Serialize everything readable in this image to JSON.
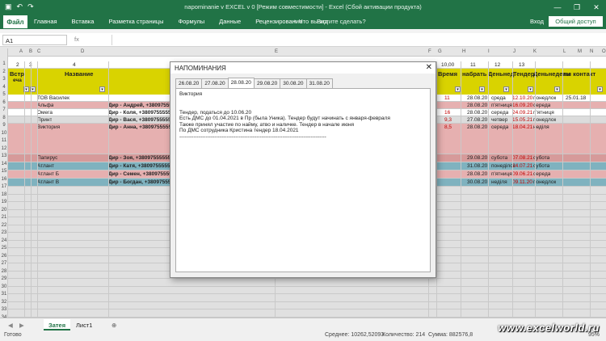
{
  "window": {
    "title": "napominanie v EXCEL v 0  [Режим совместимости] - Excel (Сбой активации продукта)",
    "minimize": "—",
    "restore": "❐",
    "close": "✕"
  },
  "qat": {
    "save_icon": "floppy-icon",
    "undo": "↶",
    "redo": "↷"
  },
  "ribbon": {
    "file": "Файл",
    "tabs": [
      "Главная",
      "Вставка",
      "Разметка страницы",
      "Формулы",
      "Данные",
      "Рецензирование",
      "Вид"
    ],
    "tellme": "♀ Что вы хотите сделать?",
    "signin": "Вход",
    "share": "Общий доступ"
  },
  "formula": {
    "namebox": "A1",
    "fx": "fx",
    "value": ""
  },
  "grid": {
    "col_letters": [
      "A",
      "B",
      "C",
      "D",
      "E",
      "F",
      "G",
      "H",
      "I",
      "J",
      "K",
      "L",
      "M",
      "N",
      "O"
    ],
    "row_numbers": [
      "1",
      "2",
      "3",
      "4",
      "5",
      "6",
      "7",
      "8",
      "9",
      "10",
      "11",
      "12",
      "13",
      "14",
      "15",
      "16",
      "17",
      "18",
      "19",
      "20",
      "21",
      "22",
      "23",
      "24",
      "25",
      "26",
      "27",
      "28",
      "29",
      "30",
      "31",
      "32",
      "33",
      "34"
    ],
    "number_row": [
      "2",
      "3",
      "4",
      "10,00",
      "11",
      "12",
      "13"
    ],
    "header": {
      "vstrecha": "Встр",
      "vstrecha2": "еча",
      "name": "Название",
      "time": "Время",
      "nabrat": "набрать",
      "dennedeli": "Деньнед",
      "tender": "Тендер",
      "dennedeli2": "Деньнедели",
      "contact": "ты контакт"
    },
    "rows": [
      {
        "company": "ТОВ Василек",
        "contact": "",
        "k": "11",
        "l": "28.08.20",
        "m": "среда",
        "n": "12.10.20",
        "o": "понедлок",
        "p": "25.01.18",
        "color": "#ffffff"
      },
      {
        "company": "Альфа",
        "contact": "Дир - Андрей, +380975555556",
        "k": "",
        "l": "28.08.20",
        "m": "п'ятниця",
        "n": "16.09.20",
        "o": "середа",
        "p": "",
        "color": "#e6b0b0"
      },
      {
        "company": "Омега",
        "contact": "Дир - Коля, +380975555556",
        "k": "16",
        "l": "28.08.20",
        "m": "середа",
        "n": "24.09.21",
        "o": "п'ятниця",
        "p": "",
        "color": "#ffffff"
      },
      {
        "company": "Принт",
        "contact": "Дир - Вася, +380975555556",
        "k": "9,3",
        "l": "27.08.20",
        "m": "четвер",
        "n": "15.05.21",
        "o": "понедлок",
        "p": "",
        "color": "#dcdcdc"
      },
      {
        "company": "Виктория",
        "contact": "Дир - Анна, +380975555556",
        "k": "8,5",
        "l": "28.08.20",
        "m": "середа",
        "n": "18.04.21",
        "o": "неділя",
        "p": "",
        "color": "#e6b0b0"
      },
      {
        "company": "Папирус",
        "contact": "Дир - Зоя, +380975555554",
        "k": "",
        "l": "29.08.20",
        "m": "субота",
        "n": "07.08.21",
        "o": "субота",
        "p": "",
        "color": "#d69a9a"
      },
      {
        "company": "Атлант",
        "contact": "Дир - Катя, +380975555556",
        "k": "",
        "l": "31.08.20",
        "m": "понеділок",
        "n": "24.07.21",
        "o": "субота",
        "p": "",
        "color": "#7fb2bf"
      },
      {
        "company": "Атлант Б",
        "contact": "Дир - Семен, +380975555556",
        "k": "",
        "l": "28.08.20",
        "m": "п'ятниця",
        "n": "09.06.21",
        "o": "середа",
        "p": "",
        "color": "#e6b0b0"
      },
      {
        "company": "Атлант В",
        "contact": "Дир - Богдан, +380975555556",
        "k": "",
        "l": "30.08.20",
        "m": "неділя",
        "n": "09.11.20",
        "o": "понедлок",
        "p": "",
        "color": "#7fb2bf"
      }
    ]
  },
  "dialog": {
    "title": "НАПОМИНАНИЯ",
    "close": "✕",
    "tabs": [
      "26.08.20",
      "27.08.20",
      "28.08.20",
      "29.08.20",
      "30.08.20",
      "31.08.20"
    ],
    "active_tab": "28.08.20",
    "lines": [
      "Виктория",
      "",
      "",
      "Тендер, податься до 10.06.20",
      "Есть ДМС до 01.04.2021 в Пр (была Уника). Тендер будут начинать с января-февраля",
      "Также принял участие по найму, атво и наличке. Тендер в начале июня",
      "По ДМС сотрудника Кристина тендер 18.04.2021",
      "------------------------------------------------------------------------------------"
    ]
  },
  "sheets": {
    "tabs": [
      "Затея",
      "Лист1"
    ],
    "active": "Затея",
    "add": "⊕"
  },
  "status": {
    "ready": "Готово",
    "average": "Среднее: 10262,52093",
    "count": "Количество: 214",
    "sum": "Сумма: 882576,8",
    "zoom": "95%"
  },
  "watermark": "www.excelworld.ru"
}
